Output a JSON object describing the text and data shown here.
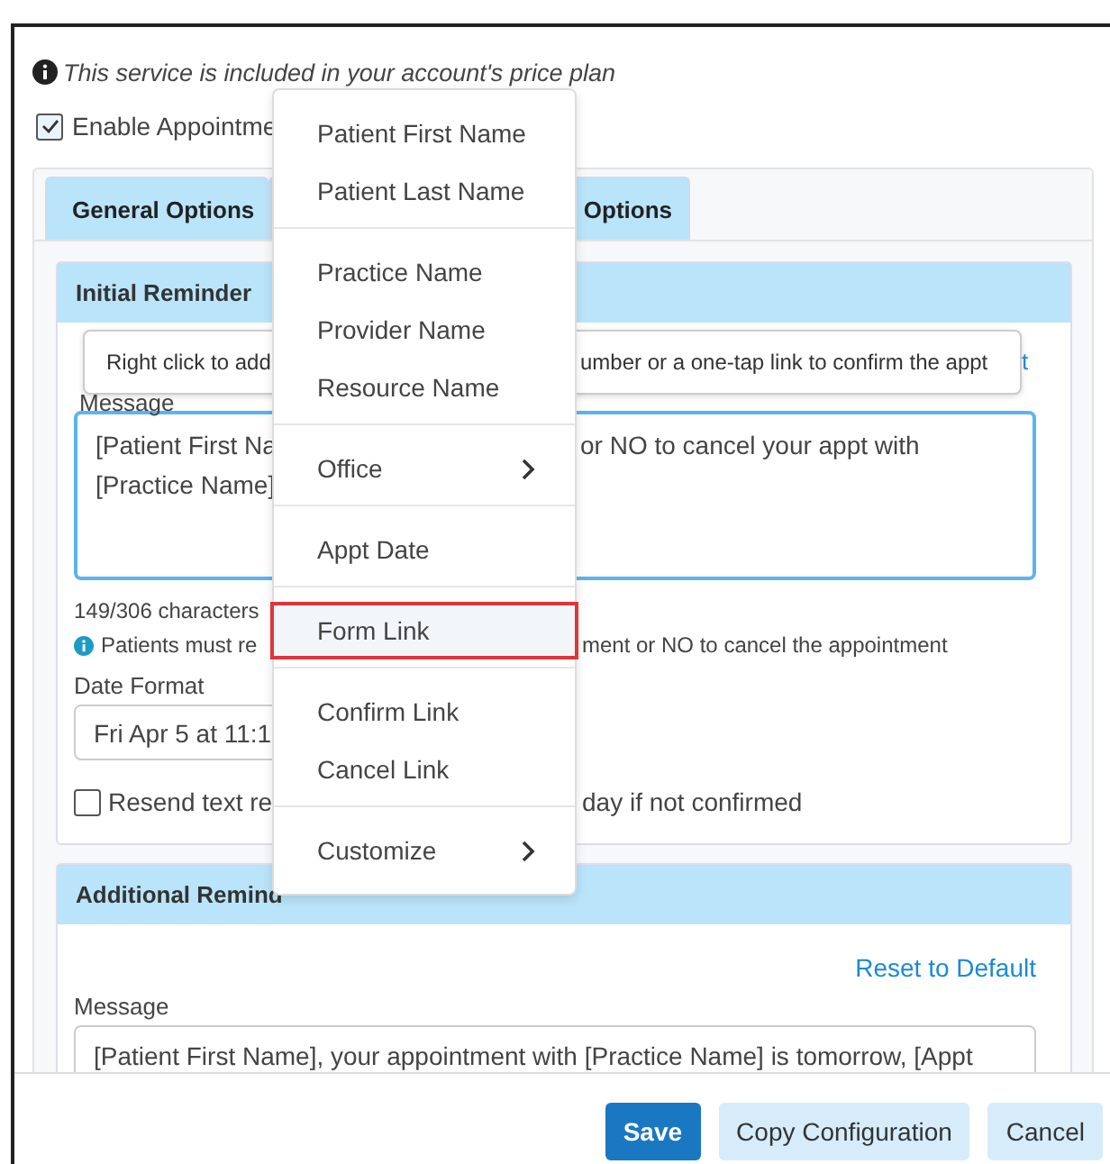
{
  "notice": {
    "text": "This service is included in your account's price plan"
  },
  "enable": {
    "label": "Enable Appointme",
    "checked": true
  },
  "tabs": [
    {
      "label": "General Options"
    },
    {
      "label": "Options"
    }
  ],
  "initial_reminder": {
    "title": "Initial Reminder",
    "tooltip": {
      "left": "Right click to add",
      "right": "umber or a one-tap link to confirm the appt"
    },
    "link_fragment": "t",
    "message_label": "Message",
    "message_lines": [
      {
        "left": "[Patient First Na",
        "right": "or NO to cancel your appt with"
      },
      {
        "left": "[Practice Name]"
      }
    ],
    "counter": "149/306 characters",
    "hint": {
      "left": "Patients must re",
      "right": "ment or NO to cancel the appointment"
    },
    "date_format_label": "Date Format",
    "date_format_value": "Fri Apr 5 at 11:1",
    "resend": {
      "left": "Resend text re",
      "right": "day if not confirmed",
      "checked": false
    }
  },
  "additional_reminder": {
    "title": "Additional Remind",
    "reset_link": "Reset to Default",
    "message_label": "Message",
    "message_value": "[Patient First Name], your appointment with [Practice Name] is tomorrow, [Appt"
  },
  "buttons": [
    {
      "label": "Save",
      "kind": "primary"
    },
    {
      "label": "Copy Configuration",
      "kind": "secondary"
    },
    {
      "label": "Cancel",
      "kind": "secondary"
    }
  ],
  "context_menu": {
    "groups": [
      [
        {
          "label": "Patient First Name",
          "selected": false,
          "submenu": false
        },
        {
          "label": "Patient Last Name",
          "selected": false,
          "submenu": false
        }
      ],
      [
        {
          "label": "Practice Name",
          "selected": false,
          "submenu": false
        },
        {
          "label": "Provider Name",
          "selected": false,
          "submenu": false
        },
        {
          "label": "Resource Name",
          "selected": false,
          "submenu": false
        }
      ],
      [
        {
          "label": "Office",
          "selected": false,
          "submenu": true
        }
      ],
      [
        {
          "label": "Appt Date",
          "selected": false,
          "submenu": false
        }
      ],
      [
        {
          "label": "Form Link",
          "selected": true,
          "submenu": false
        }
      ],
      [
        {
          "label": "Confirm Link",
          "selected": false,
          "submenu": false
        },
        {
          "label": "Cancel Link",
          "selected": false,
          "submenu": false
        }
      ],
      [
        {
          "label": "Customize",
          "selected": false,
          "submenu": true
        }
      ]
    ]
  }
}
